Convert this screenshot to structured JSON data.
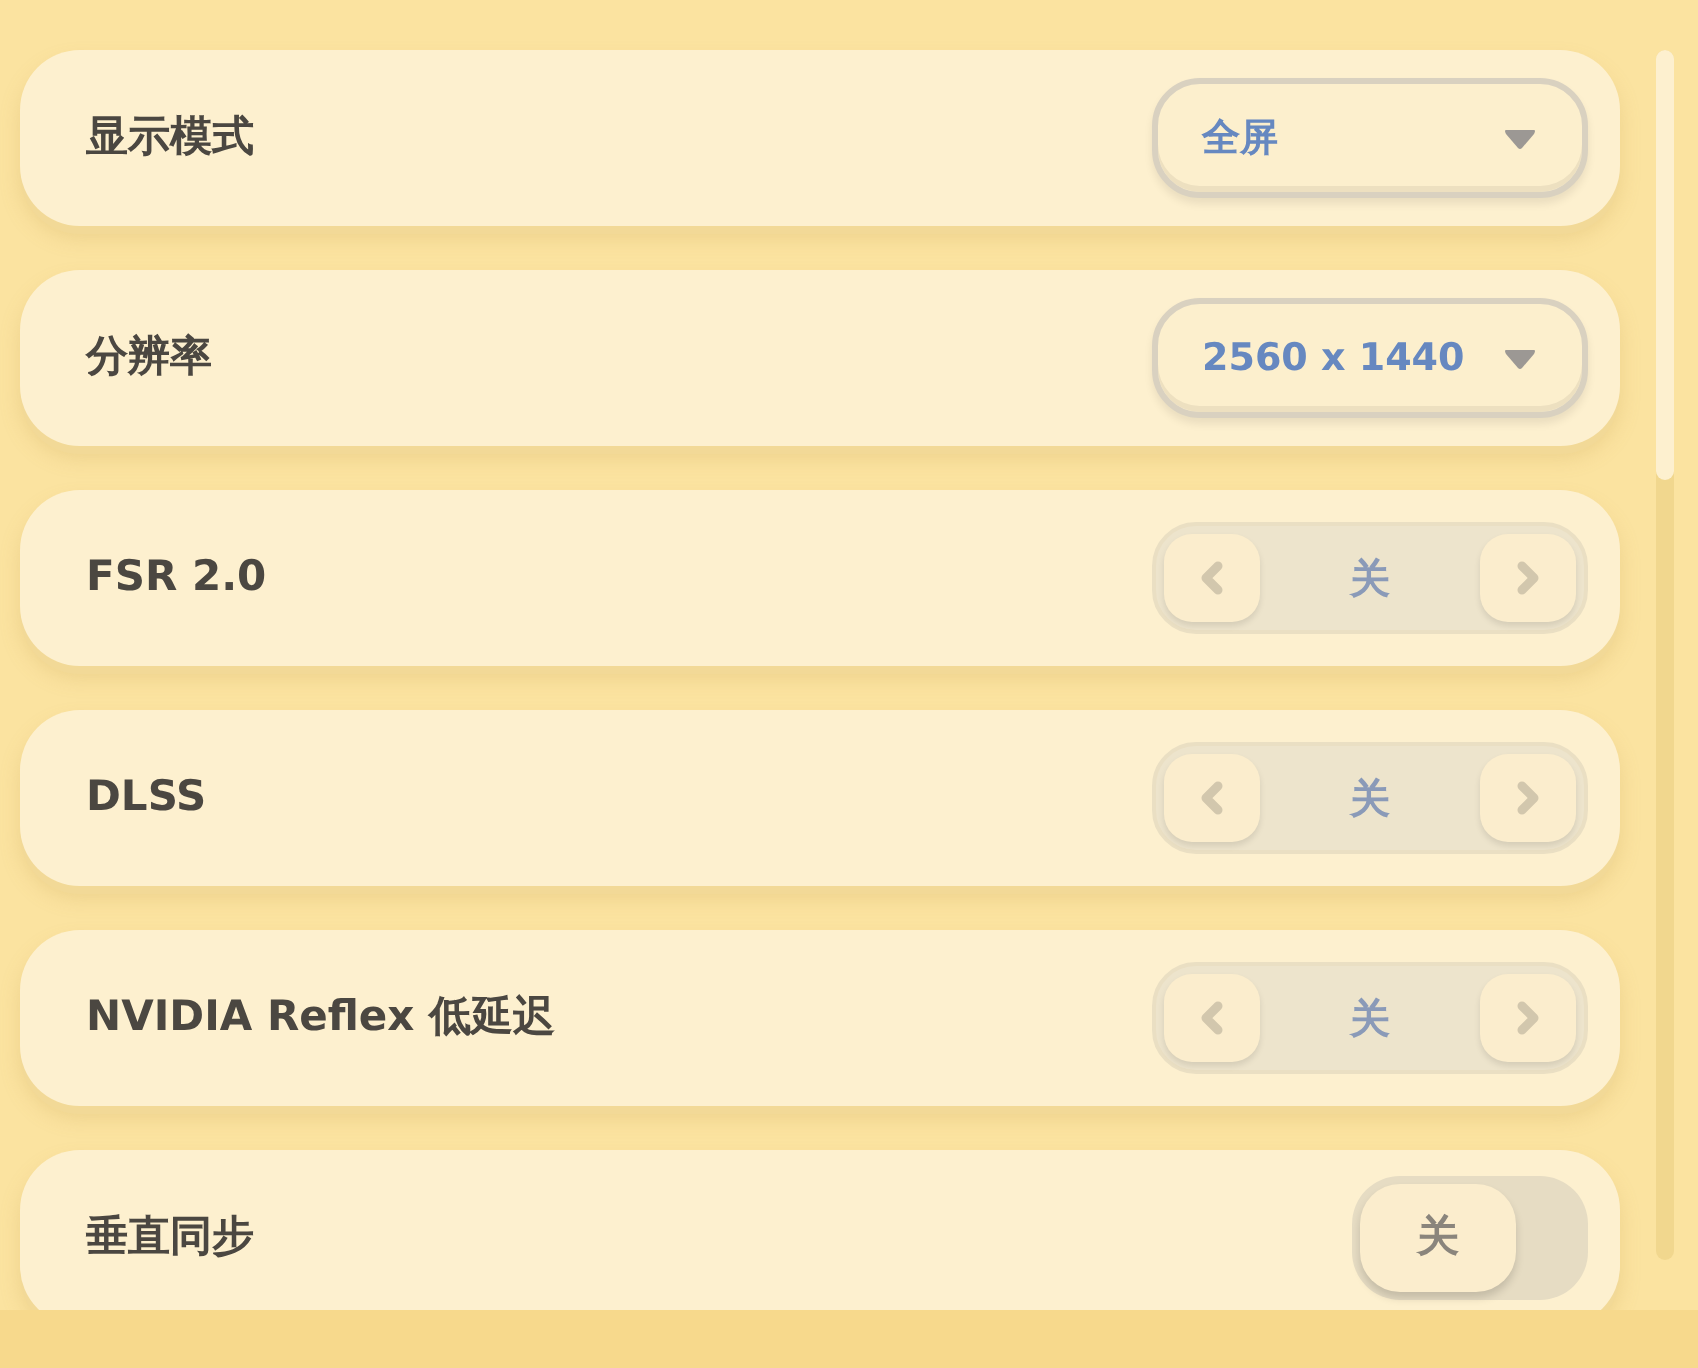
{
  "settings": [
    {
      "kind": "dropdown",
      "label": "显示模式",
      "value": "全屏",
      "disabled": false
    },
    {
      "kind": "dropdown",
      "label": "分辨率",
      "value": "2560 x 1440",
      "disabled": false
    },
    {
      "kind": "stepper",
      "label": "FSR 2.0",
      "value": "关",
      "disabled": true
    },
    {
      "kind": "stepper",
      "label": "DLSS",
      "value": "关",
      "disabled": true
    },
    {
      "kind": "stepper",
      "label": "NVIDIA Reflex 低延迟",
      "value": "关",
      "disabled": true
    },
    {
      "kind": "toggle",
      "label": "垂直同步",
      "value": "关",
      "on": false
    }
  ]
}
